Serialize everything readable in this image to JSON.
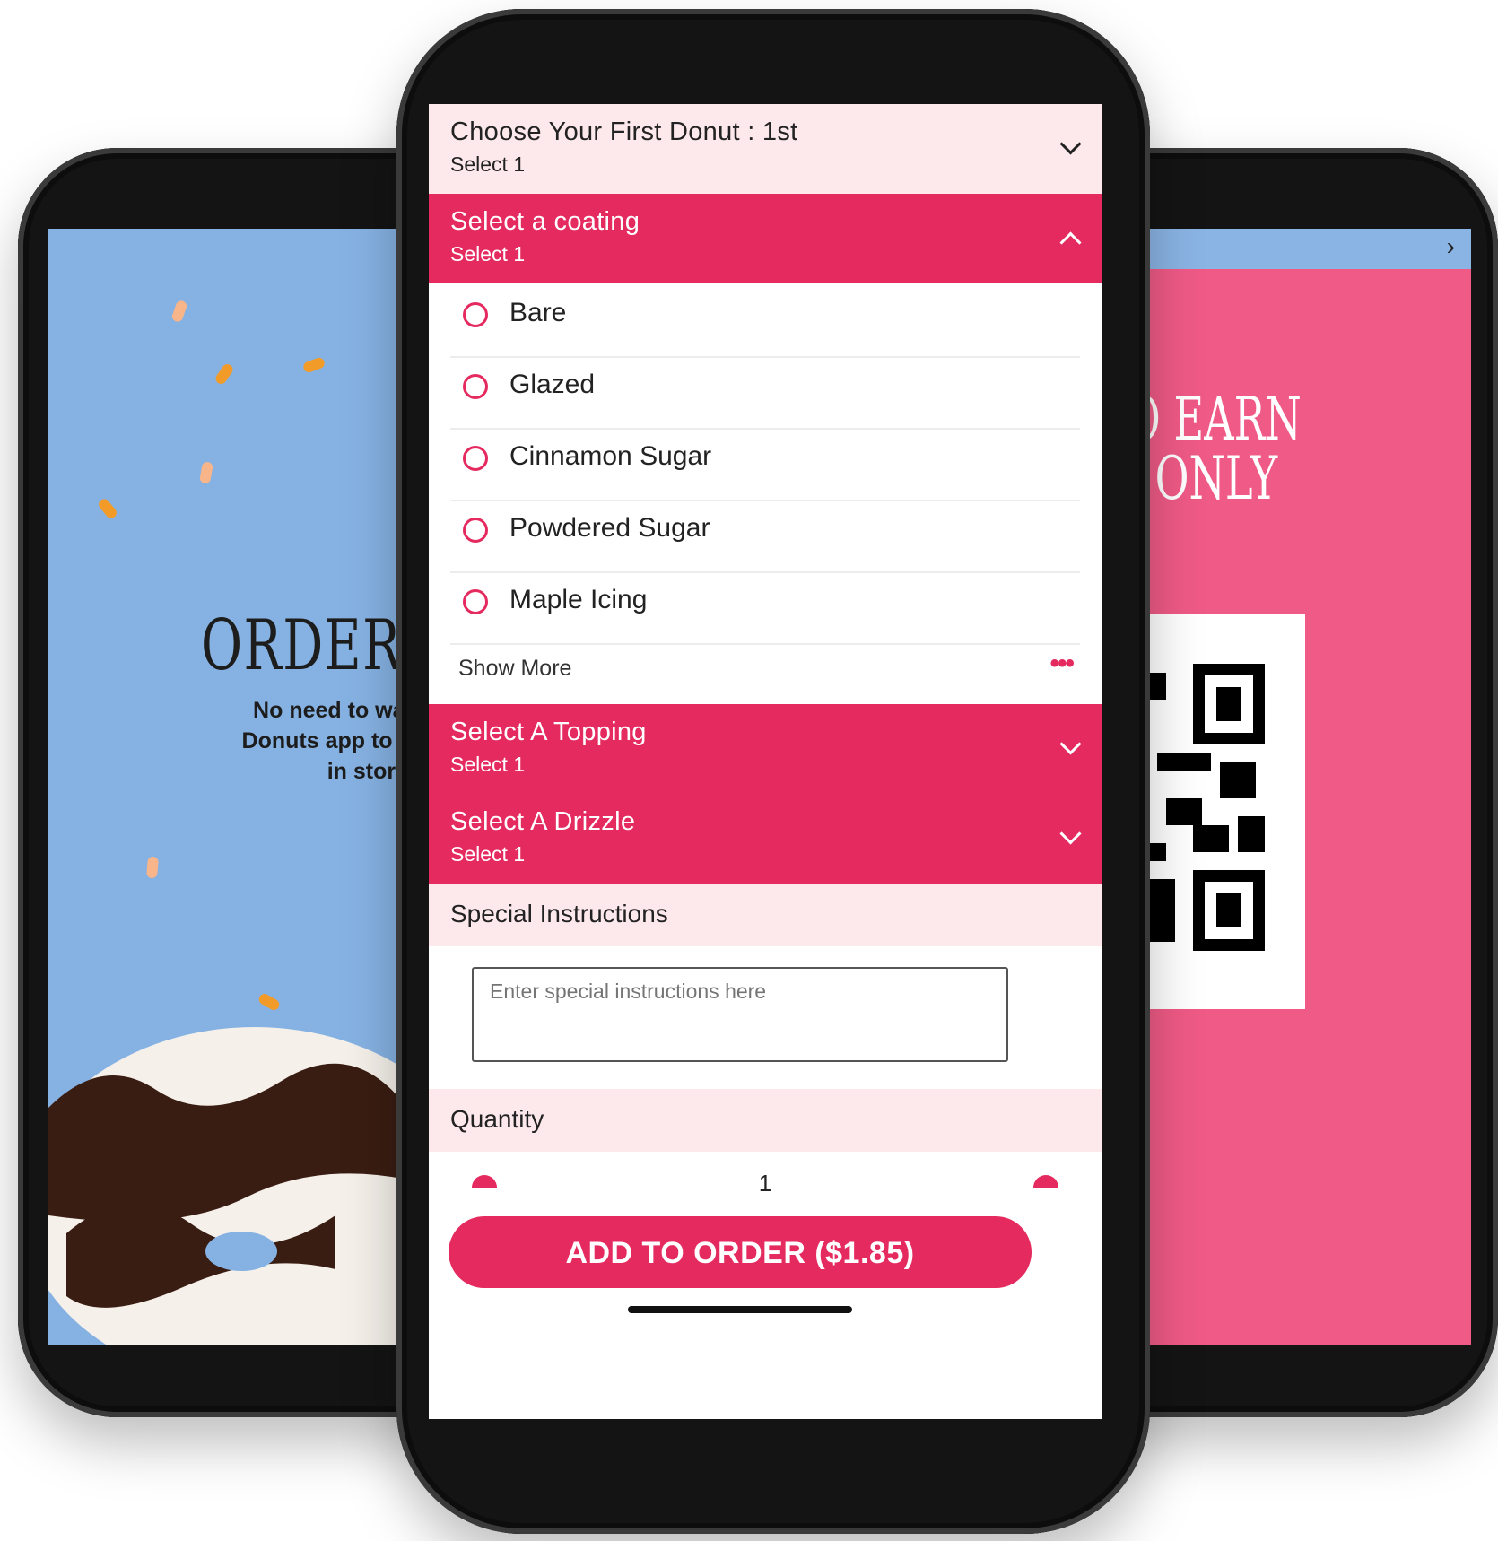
{
  "left_screen": {
    "headline": "ORDER AH",
    "body": "No need to wait in line\nDonuts app to order ahe\nin store!"
  },
  "right_screen": {
    "headline": "N TO EARN\nNTS ONLY",
    "nav_icon": "chevron-right-icon"
  },
  "order_screen": {
    "first_donut": {
      "title": "Choose Your First Donut : 1st",
      "subtitle": "Select 1"
    },
    "coating": {
      "title": "Select a coating",
      "subtitle": "Select 1",
      "options": [
        "Bare",
        "Glazed",
        "Cinnamon Sugar",
        "Powdered Sugar",
        "Maple Icing"
      ],
      "show_more": "Show More"
    },
    "topping": {
      "title": "Select A Topping",
      "subtitle": "Select 1"
    },
    "drizzle": {
      "title": "Select A Drizzle",
      "subtitle": "Select 1"
    },
    "special_instructions": {
      "label": "Special Instructions",
      "placeholder": "Enter special instructions here"
    },
    "quantity": {
      "label": "Quantity",
      "value": "1"
    },
    "add_button": "ADD TO ORDER ($1.85)"
  },
  "colors": {
    "accent": "#e42a5f",
    "light_section": "#fde8ec",
    "left_bg": "#86b2e3",
    "right_bg": "#ef5a86"
  }
}
